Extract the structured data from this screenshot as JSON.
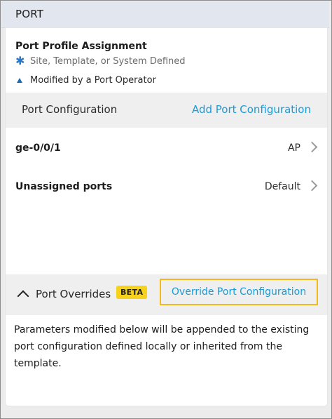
{
  "header": {
    "title": "PORT"
  },
  "assignment": {
    "title": "Port Profile Assignment",
    "legend": [
      {
        "icon": "asterisk-icon",
        "label": "Site, Template, or System Defined"
      },
      {
        "icon": "triangle-up-icon",
        "label": "Modified by a Port Operator"
      }
    ]
  },
  "port_configuration": {
    "label": "Port Configuration",
    "add_link": "Add Port Configuration",
    "rows": [
      {
        "name": "ge-0/0/1",
        "value": "AP"
      },
      {
        "name": "Unassigned ports",
        "value": "Default"
      }
    ]
  },
  "overrides": {
    "label": "Port Overrides",
    "badge": "BETA",
    "override_button": "Override Port Configuration",
    "description": "Parameters modified below will be appended to the existing port configuration defined locally or inherited from the template."
  },
  "colors": {
    "accent_link": "#1a9ad6",
    "badge_bg": "#f7d21c",
    "highlight_border": "#f2b81c",
    "legend_icon": "#2a78c8"
  }
}
